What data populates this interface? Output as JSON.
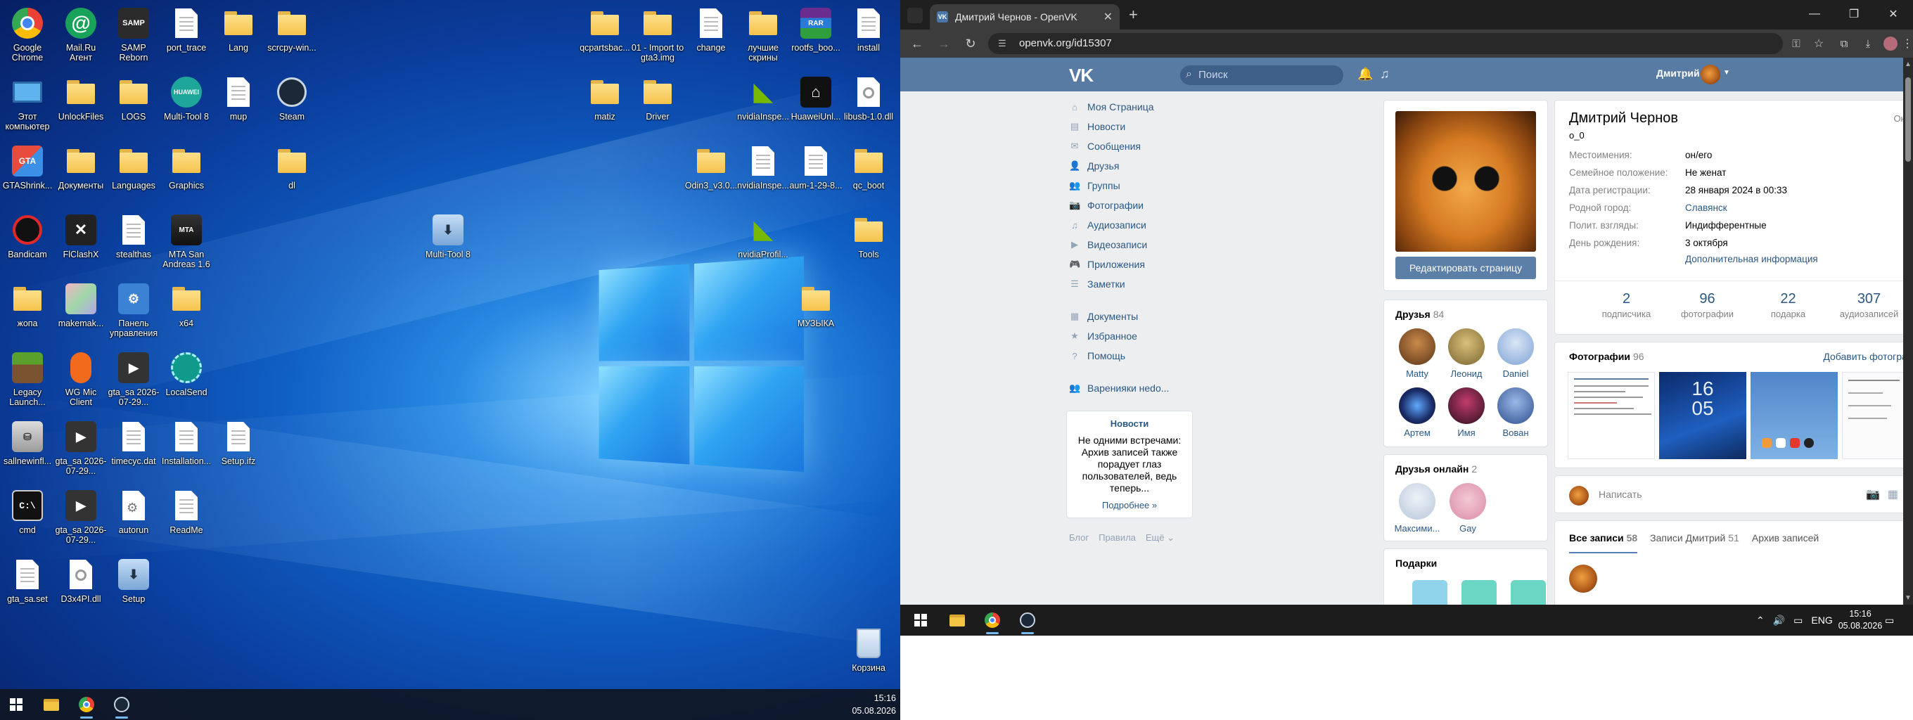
{
  "desktop": {
    "icons": [
      {
        "label": "Google Chrome",
        "kind": "chrome"
      },
      {
        "label": "Mail.Ru Агент",
        "kind": "mailru"
      },
      {
        "label": "SAMP Reborn",
        "kind": "samp"
      },
      {
        "label": "port_trace",
        "kind": "file"
      },
      {
        "label": "Lang",
        "kind": "folder"
      },
      {
        "label": "scrcpy-win...",
        "kind": "folder"
      },
      {
        "label": "qcpartsbac...",
        "kind": "folder"
      },
      {
        "label": "01 - Import to gta3.img",
        "kind": "folder"
      },
      {
        "label": "change",
        "kind": "file"
      },
      {
        "label": "лучшие скрины",
        "kind": "folder"
      },
      {
        "label": "rootfs_boo...",
        "kind": "rar"
      },
      {
        "label": "install",
        "kind": "file"
      },
      {
        "label": "Этот компьютер",
        "kind": "pc"
      },
      {
        "label": "UnlockFiles",
        "kind": "folder"
      },
      {
        "label": "LOGS",
        "kind": "folder"
      },
      {
        "label": "Multi-Tool 8",
        "kind": "huawei"
      },
      {
        "label": "mup",
        "kind": "file"
      },
      {
        "label": "Steam",
        "kind": "steam"
      },
      {
        "label": "matiz",
        "kind": "folder"
      },
      {
        "label": "Driver",
        "kind": "folder"
      },
      {
        "label": "nvidiaInspe...",
        "kind": "nvidia"
      },
      {
        "label": "HuaweiUnl...",
        "kind": "hwunl"
      },
      {
        "label": "libusb-1.0.dll",
        "kind": "dll"
      },
      {
        "label": "GTAShrink...",
        "kind": "gtashrink"
      },
      {
        "label": "Документы",
        "kind": "folder"
      },
      {
        "label": "Languages",
        "kind": "folder"
      },
      {
        "label": "Graphics",
        "kind": "folder"
      },
      {
        "label": "dl",
        "kind": "folder"
      },
      {
        "label": "Odin3_v3.0...",
        "kind": "folder"
      },
      {
        "label": "nvidiaInspe...",
        "kind": "file"
      },
      {
        "label": "aum-1-29-8...",
        "kind": "file"
      },
      {
        "label": "qc_boot",
        "kind": "folder"
      },
      {
        "label": "Bandicam",
        "kind": "bandicam"
      },
      {
        "label": "FlClashX",
        "kind": "flclash"
      },
      {
        "label": "stealthas",
        "kind": "file"
      },
      {
        "label": "MTA San Andreas 1.6",
        "kind": "mta"
      },
      {
        "label": "Multi-Tool 8",
        "kind": "installer"
      },
      {
        "label": "nvidiaProfil...",
        "kind": "nvidia"
      },
      {
        "label": "Tools",
        "kind": "folder"
      },
      {
        "label": "жопа",
        "kind": "folder"
      },
      {
        "label": "makemak...",
        "kind": "blurimg"
      },
      {
        "label": "Панель управления",
        "kind": "cpanel"
      },
      {
        "label": "x64",
        "kind": "folder"
      },
      {
        "label": "МУЗЫКА",
        "kind": "folder"
      },
      {
        "label": "Legacy Launch...",
        "kind": "minecraft"
      },
      {
        "label": "WG Mic Client",
        "kind": "wgmic"
      },
      {
        "label": "gta_sa 2026-07-29...",
        "kind": "video"
      },
      {
        "label": "LocalSend",
        "kind": "localsend"
      },
      {
        "label": "sallnewinfl...",
        "kind": "tank"
      },
      {
        "label": "gta_sa 2026-07-29...",
        "kind": "video"
      },
      {
        "label": "timecyc.dat",
        "kind": "file"
      },
      {
        "label": "Installation...",
        "kind": "file"
      },
      {
        "label": "Setup.ifz",
        "kind": "file"
      },
      {
        "label": "cmd",
        "kind": "cmd"
      },
      {
        "label": "gta_sa 2026-07-29...",
        "kind": "video"
      },
      {
        "label": "autorun",
        "kind": "autorun"
      },
      {
        "label": "ReadMe",
        "kind": "file"
      },
      {
        "label": "gta_sa.set",
        "kind": "file"
      },
      {
        "label": "D3x4PI.dll",
        "kind": "dll"
      },
      {
        "label": "Setup",
        "kind": "installer"
      },
      {
        "label": "Корзина",
        "kind": "trash"
      }
    ],
    "taskbar": {
      "time": "15:16",
      "date": "05.08.2026"
    }
  },
  "browser": {
    "tab_title": "Дмитрий Чернов - OpenVK",
    "url": "openvk.org/id15307"
  },
  "vk": {
    "search_placeholder": "Поиск",
    "user_name": "Дмитрий",
    "menu": [
      {
        "label": "Моя Страница",
        "icon": "⌂"
      },
      {
        "label": "Новости",
        "icon": "▤"
      },
      {
        "label": "Сообщения",
        "icon": "✉"
      },
      {
        "label": "Друзья",
        "icon": "👤"
      },
      {
        "label": "Группы",
        "icon": "👥"
      },
      {
        "label": "Фотографии",
        "icon": "📷"
      },
      {
        "label": "Аудиозаписи",
        "icon": "♫"
      },
      {
        "label": "Видеозаписи",
        "icon": "▶"
      },
      {
        "label": "Приложения",
        "icon": "🎮"
      },
      {
        "label": "Заметки",
        "icon": "☰"
      },
      {
        "label": "Документы",
        "icon": "▦"
      },
      {
        "label": "Избранное",
        "icon": "★"
      },
      {
        "label": "Помощь",
        "icon": "?"
      },
      {
        "label": "Варенияки неdo...",
        "icon": "👥"
      }
    ],
    "news_box": {
      "title": "Новости",
      "text": "Не одними встречами: Архив записей также порадует глаз пользователей, ведь теперь...",
      "more": "Подробнее »"
    },
    "footer": [
      "Блог",
      "Правила",
      "Ещё ⌄"
    ],
    "profile": {
      "edit_button": "Редактировать страницу",
      "name": "Дмитрий Чернов",
      "status": "о_0",
      "online": "Онлайн",
      "info": [
        {
          "k": "Местоимения:",
          "v": "он/его",
          "link": false
        },
        {
          "k": "Семейное положение:",
          "v": "Не женат",
          "link": false
        },
        {
          "k": "Дата регистрации:",
          "v": "28 января 2024 в 00:33",
          "link": false
        },
        {
          "k": "Родной город:",
          "v": "Славянск",
          "link": true
        },
        {
          "k": "Полит. взгляды:",
          "v": "Индифферентные",
          "link": false
        },
        {
          "k": "День рождения:",
          "v": "3 октября",
          "link": false
        }
      ],
      "more_info": "Дополнительная информация",
      "counters": [
        {
          "n": "2",
          "l": "подписчика"
        },
        {
          "n": "96",
          "l": "фотографии"
        },
        {
          "n": "22",
          "l": "подарка"
        },
        {
          "n": "307",
          "l": "аудиозаписей"
        }
      ]
    },
    "friends": {
      "title": "Друзья",
      "count": "84",
      "items": [
        "Matty",
        "Леонид",
        "Daniel",
        "Артем",
        "Имя",
        "Вован"
      ]
    },
    "friends_online": {
      "title": "Друзья онлайн",
      "count": "2",
      "items": [
        "Максими...",
        "Gay"
      ]
    },
    "gifts": {
      "title": "Подарки"
    },
    "photos": {
      "title": "Фотографии",
      "count": "96",
      "add": "Добавить фотографии",
      "thumb_clock": "16\n05"
    },
    "composer": {
      "placeholder": "Написать"
    },
    "wall_tabs": [
      {
        "label": "Все записи",
        "count": "58"
      },
      {
        "label": "Записи Дмитрий",
        "count": "51"
      },
      {
        "label": "Архив записей",
        "count": ""
      }
    ]
  },
  "right_taskbar": {
    "lang": "ENG",
    "time": "15:16",
    "date": "05.08.2026"
  }
}
